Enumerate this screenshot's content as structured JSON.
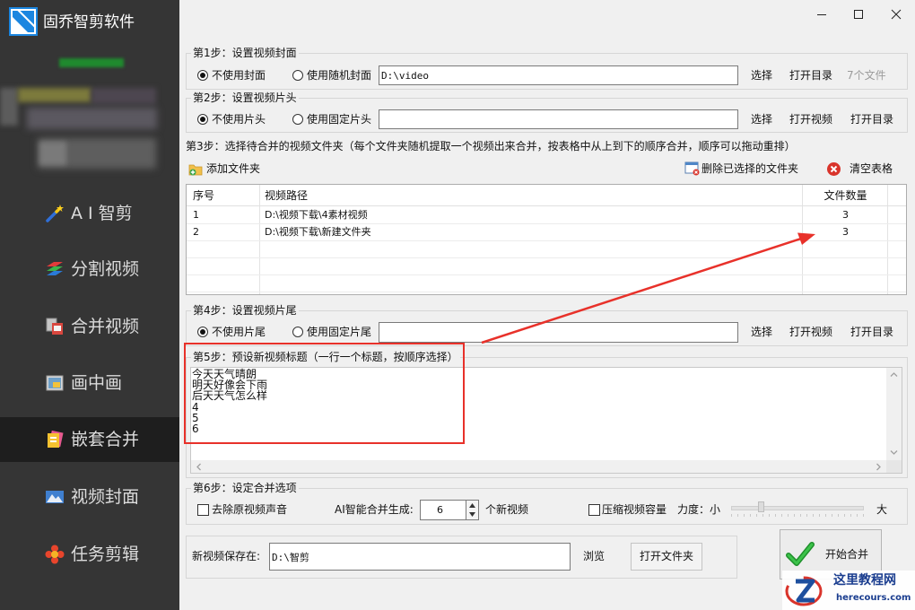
{
  "app": {
    "title": "固乔智剪软件",
    "logo_icon": "app-logo-icon"
  },
  "window_controls": {
    "minimize_icon": "minimize-icon",
    "maximize_icon": "maximize-icon",
    "close_icon": "close-icon"
  },
  "colors": {
    "sidebar_bg": "#353535",
    "sidebar_selected": "#1e1e1e",
    "highlight_red": "#e8312a",
    "panel_bg": "#f0f0f0"
  },
  "sidebar": {
    "items": [
      {
        "label": "A I 智剪",
        "icon": "ai-magic-wand-icon",
        "selected": false
      },
      {
        "label": "分割视频",
        "icon": "split-video-icon",
        "selected": false
      },
      {
        "label": "合并视频",
        "icon": "merge-video-icon",
        "selected": false
      },
      {
        "label": "画中画",
        "icon": "picture-in-picture-icon",
        "selected": false
      },
      {
        "label": "嵌套合并",
        "icon": "nested-merge-icon",
        "selected": true
      },
      {
        "label": "视频封面",
        "icon": "video-cover-icon",
        "selected": false
      },
      {
        "label": "任务剪辑",
        "icon": "task-edit-icon",
        "selected": false
      }
    ]
  },
  "step1": {
    "title": "第1步：设置视频封面",
    "option_none": {
      "label": "不使用封面",
      "checked": true
    },
    "option_random": {
      "label": "使用随机封面",
      "checked": false
    },
    "path": "D:\\video",
    "select_button": "选择",
    "open_dir_button": "打开目录",
    "file_count": "7个文件"
  },
  "step2": {
    "title": "第2步：设置视频片头",
    "option_none": {
      "label": "不使用片头",
      "checked": true
    },
    "option_fixed": {
      "label": "使用固定片头",
      "checked": false
    },
    "path": "",
    "select_button": "选择",
    "open_video_button": "打开视频",
    "open_dir_button": "打开目录"
  },
  "step3": {
    "title": "第3步：选择待合并的视频文件夹（每个文件夹随机提取一个视频出来合并，按表格中从上到下的顺序合并，顺序可以拖动重排）",
    "add_folder_button": "添加文件夹",
    "remove_selected_button": "删除已选择的文件夹",
    "clear_table_button": "清空表格",
    "table": {
      "columns": [
        "序号",
        "视频路径",
        "文件数量"
      ],
      "rows": [
        {
          "index": "1",
          "path": "D:\\视频下载\\4素材视频",
          "count": "3"
        },
        {
          "index": "2",
          "path": "D:\\视频下载\\新建文件夹",
          "count": "3"
        }
      ]
    }
  },
  "step4": {
    "title": "第4步：设置视频片尾",
    "option_none": {
      "label": "不使用片尾",
      "checked": true
    },
    "option_fixed": {
      "label": "使用固定片尾",
      "checked": false
    },
    "path": "",
    "select_button": "选择",
    "open_video_button": "打开视频",
    "open_dir_button": "打开目录"
  },
  "step5": {
    "title": "第5步：预设新视频标题（一行一个标题，按顺序选择）",
    "titles": [
      "今天天气晴朗",
      "明天好像会下雨",
      "后天天气怎么样",
      "4",
      "5",
      "6"
    ]
  },
  "step6": {
    "title": "第6步：设定合并选项",
    "remove_audio": {
      "label": "去除原视频声音",
      "checked": false
    },
    "ai_generate_label": "AI智能合并生成:",
    "ai_generate_count": "6",
    "ai_generate_unit": "个新视频",
    "compress": {
      "label": "压缩视频容量",
      "checked": false
    },
    "strength_label": "力度：小",
    "strength_max_label": "大",
    "strength_level": 0.22
  },
  "output": {
    "label": "新视频保存在:",
    "path": "D:\\智剪",
    "browse_button": "浏览",
    "open_folder_button": "打开文件夹"
  },
  "start_button": {
    "label": "开始合并",
    "icon": "green-check-icon"
  },
  "watermark": {
    "name": "这里教程网",
    "url": "herecours.com"
  }
}
